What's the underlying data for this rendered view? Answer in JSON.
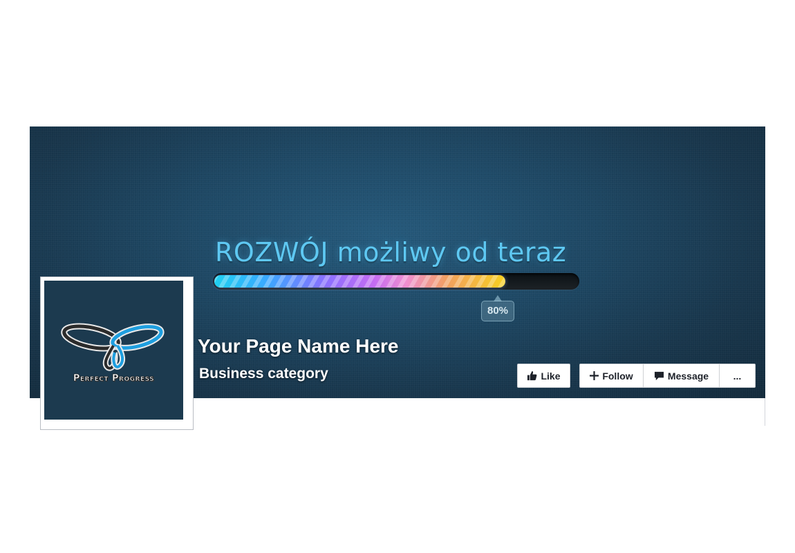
{
  "cover": {
    "headline": "ROZWÓJ możliwy od teraz",
    "progress": {
      "percent": 80,
      "label": "80%"
    }
  },
  "page": {
    "name": "Your Page Name Here",
    "category": "Business category"
  },
  "profile": {
    "logo_text": "Perfect Progress",
    "logo_icon": "butterfly-logo-icon"
  },
  "actions": {
    "like_label": "Like",
    "like_icon": "thumbs-up-icon",
    "follow_label": "Follow",
    "follow_icon": "plus-icon",
    "message_label": "Message",
    "message_icon": "speech-bubble-icon",
    "more_label": "..."
  },
  "colors": {
    "cover_bg": "#1e4966",
    "headline": "#5ec8f2",
    "button_text": "#1d2129",
    "button_border": "#ced0d4"
  }
}
